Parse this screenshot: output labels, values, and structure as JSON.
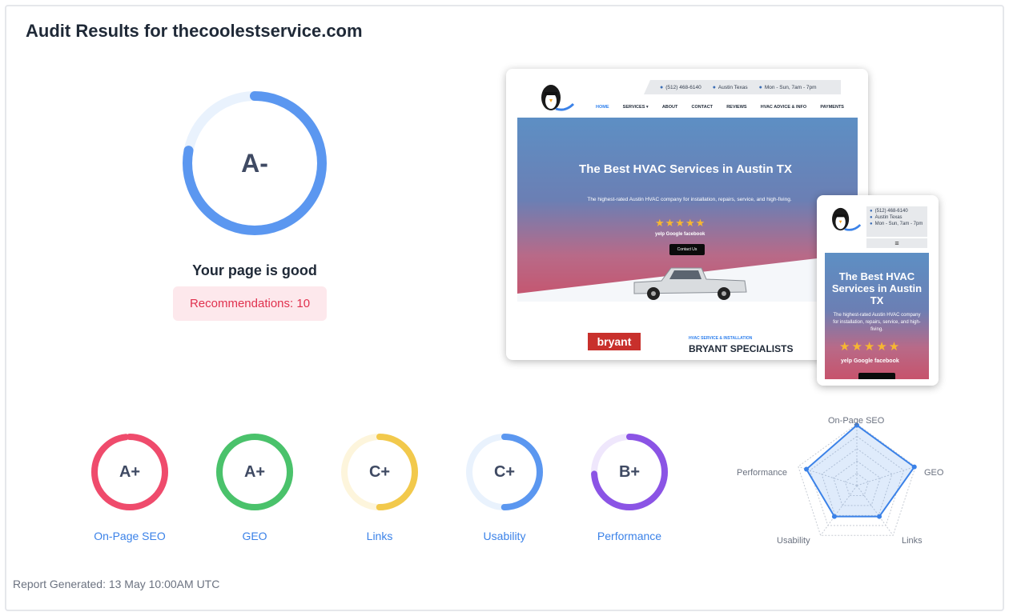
{
  "audit": {
    "title": "Audit Results for thecoolestservice.com",
    "overall_grade": "A-",
    "overall_progress": 0.78,
    "status_text": "Your page is good",
    "recommendations_label": "Recommendations: 10",
    "report_generated": "Report Generated: 13 May 10:00AM UTC"
  },
  "colors": {
    "main_ring": "#5b97f0",
    "main_ring_track": "#e9f2fd",
    "onpage": "#ef4b6c",
    "geo": "#4ac26b",
    "links": "#f2c94c",
    "usability": "#5b97f0",
    "performance": "#8b54e5",
    "radar": "#3b82e8"
  },
  "categories": [
    {
      "label": "On-Page SEO",
      "grade": "A+",
      "progress": 0.98,
      "color": "#ef4b6c",
      "track": "#fde3e8"
    },
    {
      "label": "GEO",
      "grade": "A+",
      "progress": 1.0,
      "color": "#4ac26b",
      "track": "#e3f6e8"
    },
    {
      "label": "Links",
      "grade": "C+",
      "progress": 0.5,
      "color": "#f2c94c",
      "track": "#fdf5dc"
    },
    {
      "label": "Usability",
      "grade": "C+",
      "progress": 0.5,
      "color": "#5b97f0",
      "track": "#e9f2fd"
    },
    {
      "label": "Performance",
      "grade": "B+",
      "progress": 0.74,
      "color": "#8b54e5",
      "track": "#efe7fc"
    }
  ],
  "radar": {
    "axes": [
      "On-Page SEO",
      "GEO",
      "Links",
      "Usability",
      "Performance"
    ],
    "values": [
      0.98,
      0.98,
      0.62,
      0.62,
      0.86
    ]
  },
  "desktop_preview": {
    "phone": "(512) 468-6140",
    "location": "Austin Texas",
    "hours": "Mon - Sun, 7am - 7pm",
    "nav": [
      "HOME",
      "SERVICES ▾",
      "ABOUT",
      "CONTACT",
      "REVIEWS",
      "HVAC ADVICE & INFO",
      "PAYMENTS"
    ],
    "hero_title": "The Best HVAC Services in Austin TX",
    "hero_subtitle": "The highest-rated Austin HVAC company for installation, repairs, service, and high-fiving.",
    "stars": "★★★★★",
    "reviews": "yelp Google facebook",
    "contact_button": "Contact Us",
    "brand": "bryant",
    "kicker": "HVAC SERVICE & INSTALLATION",
    "section_title": "BRYANT SPECIALISTS"
  },
  "mobile_preview": {
    "phone": "(512) 468-6140",
    "location": "Austin Texas",
    "hours": "Mon - Sun, 7am - 7pm",
    "menu_icon": "≡",
    "hero_title": "The Best HVAC Services in Austin TX",
    "hero_subtitle": "The highest-rated Austin HVAC company for installation, repairs, service, and high-fiving.",
    "stars": "★★★★★",
    "reviews": "yelp Google facebook"
  }
}
